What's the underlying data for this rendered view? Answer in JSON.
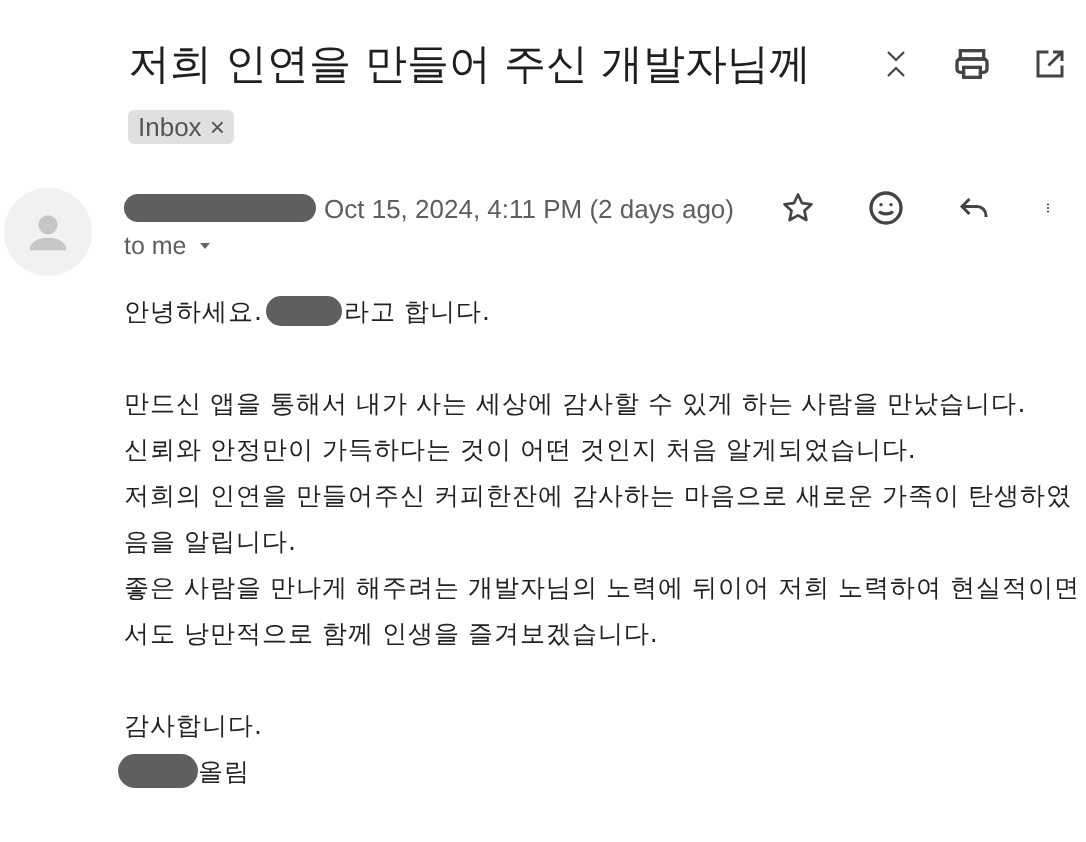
{
  "subject": "저희 인연을 만들어 주신 개발자님께",
  "labels": [
    {
      "text": "Inbox",
      "remove": "×"
    }
  ],
  "message": {
    "date": "Oct 15, 2024, 4:11 PM (2 days ago)",
    "recipient": "to me",
    "greeting": {
      "before": "안녕하세요.",
      "after": "라고 합니다."
    },
    "paragraphs": [
      [
        "만드신 앱을 통해서 내가 사는 세상에 감사할 수 있게 하는 사람을 만났습니다.",
        "신뢰와 안정만이 가득하다는 것이 어떤 것인지 처음 알게되었습니다.",
        "저희의 인연을 만들어주신 커피한잔에 감사하는 마음으로 새로운 가족이 탄생하였",
        "음을 알립니다.",
        "좋은 사람을 만나게 해주려는 개발자님의 노력에 뒤이어 저희 노력하여 현실적이면",
        "서도 낭만적으로 함께 인생을 즐겨보겠습니다."
      ]
    ],
    "closing": "감사합니다.",
    "signature_after": "올림"
  }
}
